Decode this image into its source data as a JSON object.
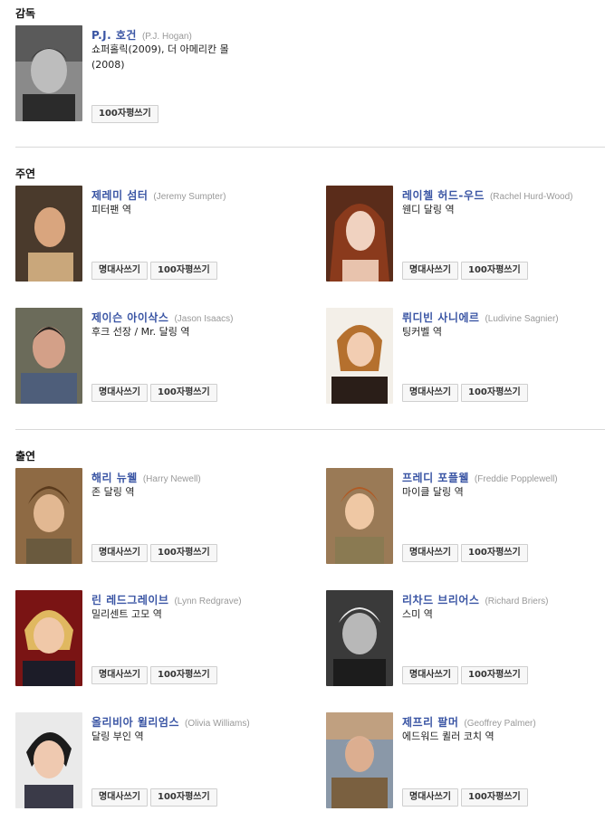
{
  "sections": {
    "director": "감독",
    "main_cast": "주연",
    "supporting_cast": "출연"
  },
  "buttons": {
    "quote": "명대사쓰기",
    "review": "100자평쓰기"
  },
  "director": {
    "name": "P.J. 호건",
    "original": "(P.J. Hogan)",
    "works": "쇼퍼홀릭(2009), 더 아메리칸 몰(2008)"
  },
  "main_cast": [
    {
      "name": "제레미 섬터",
      "original": "(Jeremy Sumpter)",
      "role": "피터팬 역"
    },
    {
      "name": "레이첼 허드-우드",
      "original": "(Rachel Hurd-Wood)",
      "role": "웬디 달링 역"
    },
    {
      "name": "제이슨 아이삭스",
      "original": "(Jason Isaacs)",
      "role": "후크 선장 / Mr. 달링 역"
    },
    {
      "name": "뤼디빈 사니에르",
      "original": "(Ludivine Sagnier)",
      "role": "팅커벨 역"
    }
  ],
  "supporting_cast": [
    {
      "name": "해리 뉴웰",
      "original": "(Harry Newell)",
      "role": "존 달링 역"
    },
    {
      "name": "프레디 포플웰",
      "original": "(Freddie Popplewell)",
      "role": "마이클 달링 역"
    },
    {
      "name": "린 레드그레이브",
      "original": "(Lynn Redgrave)",
      "role": "밀리센트 고모 역"
    },
    {
      "name": "리차드 브리어스",
      "original": "(Richard Briers)",
      "role": "스미 역"
    },
    {
      "name": "올리비아 윌리엄스",
      "original": "(Olivia Williams)",
      "role": "달링 부인 역"
    },
    {
      "name": "제프리 팔머",
      "original": "(Geoffrey Palmer)",
      "role": "에드워드 퀼러 코치 역"
    }
  ]
}
